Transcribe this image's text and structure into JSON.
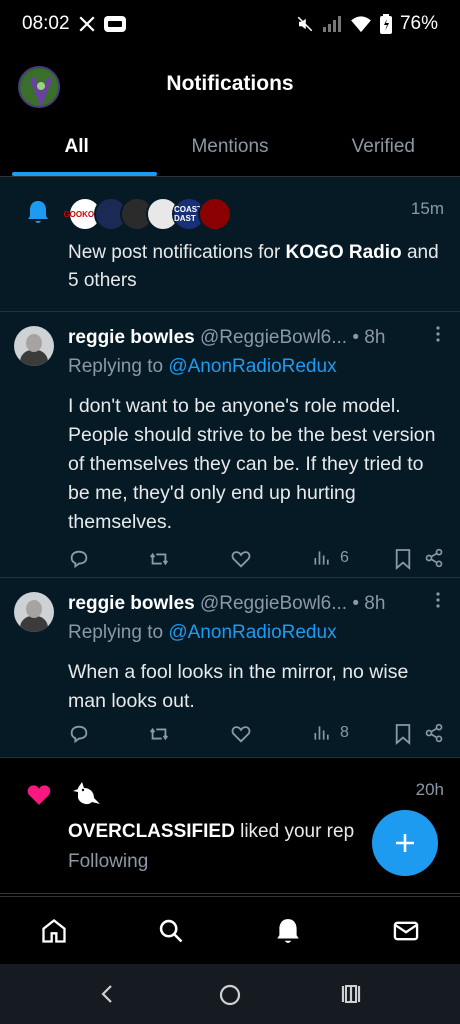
{
  "status_bar": {
    "time": "08:02",
    "battery": "76%"
  },
  "header": {
    "title": "Notifications"
  },
  "tabs": [
    {
      "label": "All"
    },
    {
      "label": "Mentions"
    },
    {
      "label": "Verified"
    }
  ],
  "notifications": {
    "posts_group": {
      "time": "15m",
      "text_prefix": "New post notifications for ",
      "account": "KOGO Radio",
      "text_suffix": " and 5 others",
      "avatars": [
        "GOOKOGO",
        "",
        "",
        "",
        "COAST DAST",
        ""
      ]
    },
    "reply1": {
      "name": "reggie bowles",
      "handle": "@ReggieBowl6...",
      "sep": " • ",
      "time": "8h",
      "replying_prefix": "Replying to ",
      "replying_to": "@AnonRadioRedux",
      "text": "I don't want to be anyone's role model. People should strive to be the best version of themselves they can be. If they tried to be me, they'd only end up hurting themselves.",
      "views": "6"
    },
    "reply2": {
      "name": "reggie bowles",
      "handle": "@ReggieBowl6...",
      "sep": " • ",
      "time": "8h",
      "replying_prefix": "Replying to ",
      "replying_to": "@AnonRadioRedux",
      "text": "When a fool looks in the mirror, no wise man looks out.",
      "views": "8"
    },
    "like": {
      "time": "20h",
      "actor": "OVERCLASSIFIED",
      "text_suffix": " liked your rep",
      "subtext": "Following"
    }
  },
  "colors": {
    "accent": "#1d9bf0",
    "like": "#f91880",
    "highlight_bg": "#061a26"
  },
  "icons": {
    "bottom_nav": [
      "home-icon",
      "search-icon",
      "notifications-icon",
      "messages-icon"
    ],
    "system_nav": [
      "back-icon",
      "home-circle-icon",
      "recents-icon"
    ]
  }
}
